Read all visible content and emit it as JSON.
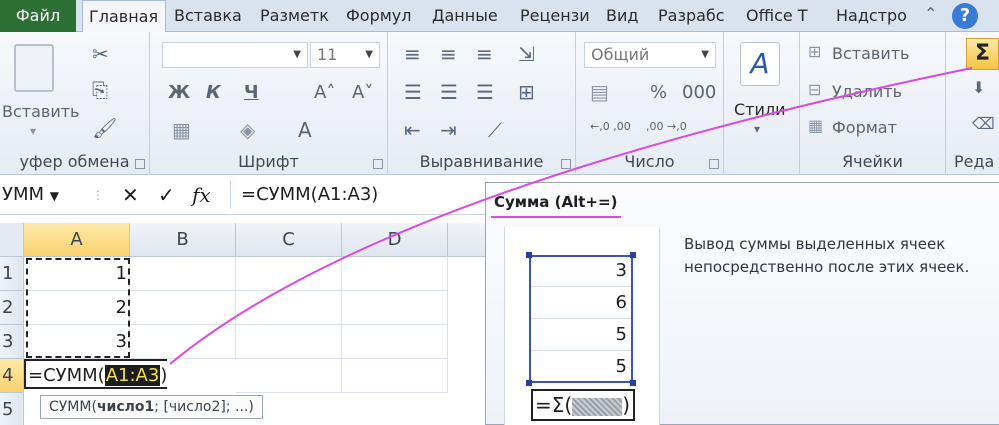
{
  "tabs": [
    "Файл",
    "Главная",
    "Вставка",
    "Разметк",
    "Формул",
    "Данные",
    "Рецензи",
    "Вид",
    "Разрабс",
    "Office T",
    "Надстро"
  ],
  "help_glyph": "?",
  "ribbon": {
    "clipboard": {
      "label": "уфер обмена",
      "paste_label": "Вставить"
    },
    "font": {
      "label": "Шрифт",
      "font_name": "",
      "font_size": "11",
      "bold": "Ж",
      "italic": "К",
      "underline": "Ч",
      "grow": "A˄",
      "shrink": "A˅",
      "font_color": "A"
    },
    "alignment": {
      "label": "Выравнивание"
    },
    "number": {
      "label": "Число",
      "format": "Общий",
      "percent": "%",
      "thousands": "000",
      "inc_decimal": "←,0 ,00",
      "dec_decimal": ",00 →,0"
    },
    "styles": {
      "label": "Стили",
      "glyph": "A"
    },
    "cells": {
      "label": "Ячейки",
      "insert": "Вставить",
      "delete": "Удалить",
      "format": "Формат"
    },
    "editing": {
      "label": "Реда",
      "sum_glyph": "Σ"
    }
  },
  "formula_bar": {
    "name_box": "УММ",
    "cancel": "✕",
    "enter": "✓",
    "fx": "fx",
    "formula": "=СУММ(А1:А3)"
  },
  "sheet": {
    "columns": [
      "A",
      "B",
      "C",
      "D"
    ],
    "rows": [
      "1",
      "2",
      "3",
      "4",
      "5"
    ],
    "values": [
      "1",
      "2",
      "3"
    ],
    "edit_prefix": "=СУММ(",
    "edit_ref": "A1:A3",
    "edit_suffix": ")",
    "tooltip_prefix": "СУММ(",
    "tooltip_bold": "число1",
    "tooltip_rest": "; [число2]; ...)"
  },
  "screentip": {
    "title": "Сумма (Alt+=)",
    "description": "Вывод суммы выделенных ячеек непосредственно после этих ячеек.",
    "mini_values": [
      "3",
      "6",
      "5",
      "5"
    ],
    "mini_formula_prefix": "=Σ(",
    "mini_formula_suffix": ")"
  },
  "colors": {
    "file_tab": "#2e6f36",
    "accent_line": "#d94bd9",
    "autosum_highlight": "#f6c343",
    "ref_highlight": "#f4e04d"
  }
}
